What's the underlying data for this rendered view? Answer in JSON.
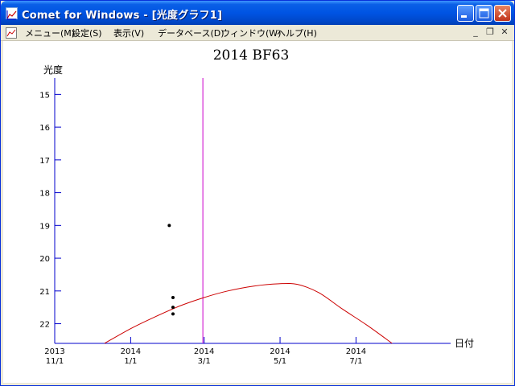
{
  "window": {
    "title": "Comet for Windows - [光度グラフ1]"
  },
  "menu": {
    "items": [
      "メニュー(M)",
      "設定(S)",
      "表示(V)",
      "データベース(D)",
      "ウィンドウ(W)",
      "ヘルプ(H)"
    ]
  },
  "icons": {
    "app": "graph-app-icon",
    "minimize": "minimize-icon",
    "maximize": "maximize-icon",
    "close": "close-icon"
  },
  "colors": {
    "axis": "#0000cc",
    "curve": "#cc0000",
    "today_line": "#cc00cc",
    "points": "#000000"
  },
  "chart_data": {
    "type": "scatter",
    "title": "2014 BF63",
    "ylabel": "光度",
    "xlabel": "日付",
    "y_axis_inverted": true,
    "ylim": [
      22.6,
      14.5
    ],
    "xlim": [
      "2013-11-01",
      "2014-09-15"
    ],
    "yticks": [
      15,
      16,
      17,
      18,
      19,
      20,
      21,
      22
    ],
    "xticks": [
      {
        "date": "2013-11-01",
        "year": "2013",
        "md": "11/1"
      },
      {
        "date": "2014-01-01",
        "year": "2014",
        "md": "1/1"
      },
      {
        "date": "2014-03-01",
        "year": "2014",
        "md": "3/1"
      },
      {
        "date": "2014-05-01",
        "year": "2014",
        "md": "5/1"
      },
      {
        "date": "2014-07-01",
        "year": "2014",
        "md": "7/1"
      }
    ],
    "vertical_marker": {
      "date": "2014-02-28"
    },
    "observations": [
      {
        "date": "2014-02-01",
        "mag": 19.0
      },
      {
        "date": "2014-02-04",
        "mag": 21.2
      },
      {
        "date": "2014-02-04",
        "mag": 21.5
      },
      {
        "date": "2014-02-04",
        "mag": 21.7
      }
    ],
    "curve": [
      {
        "date": "2013-12-11",
        "mag": 22.6
      },
      {
        "date": "2014-01-01",
        "mag": 22.15
      },
      {
        "date": "2014-01-20",
        "mag": 21.8
      },
      {
        "date": "2014-02-10",
        "mag": 21.45
      },
      {
        "date": "2014-03-01",
        "mag": 21.2
      },
      {
        "date": "2014-03-20",
        "mag": 21.0
      },
      {
        "date": "2014-04-10",
        "mag": 20.85
      },
      {
        "date": "2014-04-30",
        "mag": 20.78
      },
      {
        "date": "2014-05-15",
        "mag": 20.8
      },
      {
        "date": "2014-06-01",
        "mag": 21.05
      },
      {
        "date": "2014-06-20",
        "mag": 21.55
      },
      {
        "date": "2014-07-10",
        "mag": 22.05
      },
      {
        "date": "2014-07-30",
        "mag": 22.6
      }
    ],
    "grid": false,
    "legend": "none"
  }
}
